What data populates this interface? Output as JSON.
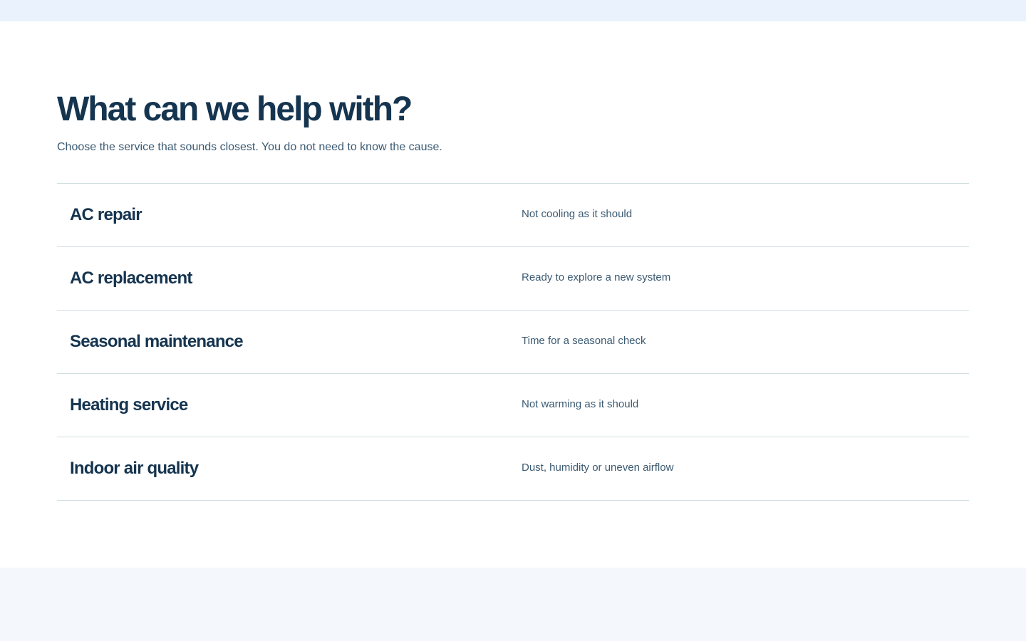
{
  "header": {
    "title": "What can we help with?",
    "subtitle": "Choose the service that sounds closest. You do not need to know the cause."
  },
  "services": [
    {
      "name": "AC repair",
      "description": "Not cooling as it should"
    },
    {
      "name": "AC replacement",
      "description": "Ready to explore a new system"
    },
    {
      "name": "Seasonal maintenance",
      "description": "Time for a seasonal check"
    },
    {
      "name": "Heating service",
      "description": "Not warming as it should"
    },
    {
      "name": "Indoor air quality",
      "description": "Dust, humidity or uneven airflow"
    }
  ],
  "colors": {
    "heading": "#15344f",
    "body_text": "#3b5a72",
    "divider": "#cfdde0",
    "top_band": "#eaf3fd",
    "bottom_band": "#f4f8fc"
  }
}
